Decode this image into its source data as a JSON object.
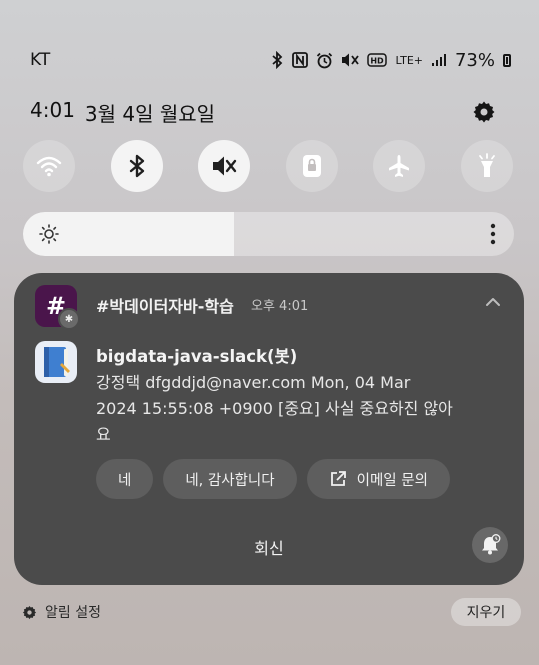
{
  "status_bar": {
    "carrier": "KT",
    "network": "LTE+",
    "battery": "73%",
    "icons": [
      "bluetooth-icon",
      "nfc-icon",
      "alarm-icon",
      "vibrate-icon",
      "hd-voice-icon",
      "lte-icon",
      "signal-icon",
      "battery-icon"
    ]
  },
  "header": {
    "time": "4:01",
    "date": "3월 4일 월요일"
  },
  "quick_tiles": [
    {
      "name": "wifi",
      "icon": "wifi-icon",
      "active": false
    },
    {
      "name": "bluetooth",
      "icon": "bluetooth-icon",
      "active": true
    },
    {
      "name": "sound",
      "icon": "vibrate-icon",
      "active": true
    },
    {
      "name": "rotation-lock",
      "icon": "lock-icon",
      "active": false
    },
    {
      "name": "airplane-mode",
      "icon": "airplane-icon",
      "active": false
    },
    {
      "name": "flashlight",
      "icon": "flashlight-icon",
      "active": false
    }
  ],
  "brightness": {
    "level": 0.43
  },
  "notification": {
    "app_icon_text": "#",
    "channel": "#박데이터자바-학습",
    "time": "오후 4:01",
    "sender": "bigdata-java-slack(봇)",
    "body": "강정택 dfgddjd@naver.com Mon, 04 Mar 2024 15:55:08 +0900 [중요] 사실 중요하진 않아요",
    "actions": [
      "네",
      "네, 감사합니다",
      "이메일 문의"
    ],
    "reply": "회신"
  },
  "footer": {
    "settings": "알림 설정",
    "clear": "지우기"
  },
  "colors": {
    "card_bg": "#4b4b4b",
    "slack_purple": "#4a154b",
    "chip_bg": "#5e5e5e"
  }
}
